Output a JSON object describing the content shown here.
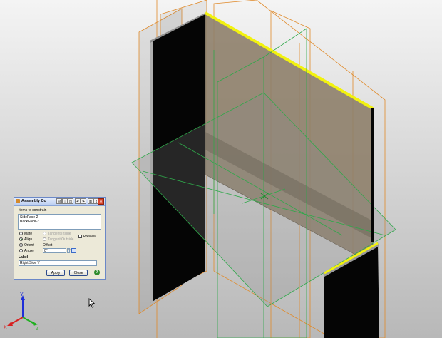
{
  "dialog": {
    "title": "Assembly Co",
    "toolbar_buttons": [
      "M",
      "↕",
      "⊡",
      "↶",
      "↷",
      "⊠",
      "⇕"
    ],
    "close_glyph": "✕",
    "items_label": "Items to constrain",
    "items": [
      "SideFace-2",
      "BackFace-2"
    ],
    "constraint_types": [
      {
        "label": "Mate",
        "selected": false
      },
      {
        "label": "Align",
        "selected": true
      },
      {
        "label": "Orient",
        "selected": false
      },
      {
        "label": "Angle",
        "selected": false
      }
    ],
    "tangent_inside": "Tangent Inside",
    "tangent_outside": "Tangent Outside",
    "preview_label": "Preview",
    "offset_label": "Offset",
    "angle_value": "0°",
    "label_heading": "Label",
    "label_value": "Right Side Y",
    "apply_label": "Apply",
    "close_label": "Close",
    "help_glyph": "?"
  },
  "triad": {
    "x_label": "X",
    "y_label": "Y",
    "z_label": "Z"
  },
  "colors": {
    "background_top": "#f4f4f4",
    "background_bottom": "#b7b7b7",
    "panel_tan": "#8e806a",
    "black_face": "#050505",
    "highlight_edge": "#f2f20f",
    "datum_orange": "#e08a2a",
    "datum_green": "#2fa84a"
  }
}
